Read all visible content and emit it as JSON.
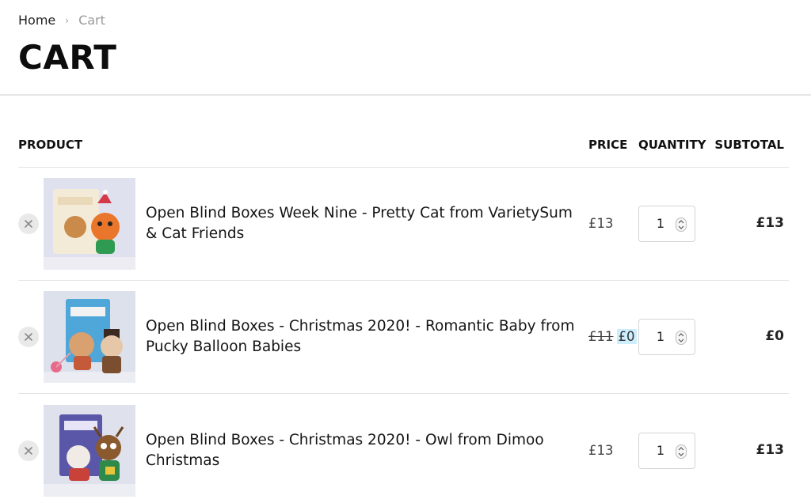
{
  "breadcrumb": {
    "home": "Home",
    "separator": "›",
    "current": "Cart"
  },
  "page": {
    "title": "CART"
  },
  "table": {
    "headers": {
      "product": "PRODUCT",
      "price": "PRICE",
      "quantity": "QUANTITY",
      "subtotal": "SUBTOTAL"
    }
  },
  "items": [
    {
      "name": "Open Blind Boxes Week Nine - Pretty Cat from VarietySum & Cat Friends",
      "price": "£13",
      "quantity": "1",
      "subtotal": "£13"
    },
    {
      "name": "Open Blind Boxes - Christmas 2020! - Romantic Baby from Pucky Balloon Babies",
      "price_old": "£11",
      "price": "£0",
      "quantity": "1",
      "subtotal": "£0"
    },
    {
      "name": "Open Blind Boxes - Christmas 2020! - Owl from Dimoo Christmas",
      "price": "£13",
      "quantity": "1",
      "subtotal": "£13"
    }
  ],
  "icons": {
    "remove": "close-icon",
    "spinner": "spinner-arrows-icon"
  }
}
